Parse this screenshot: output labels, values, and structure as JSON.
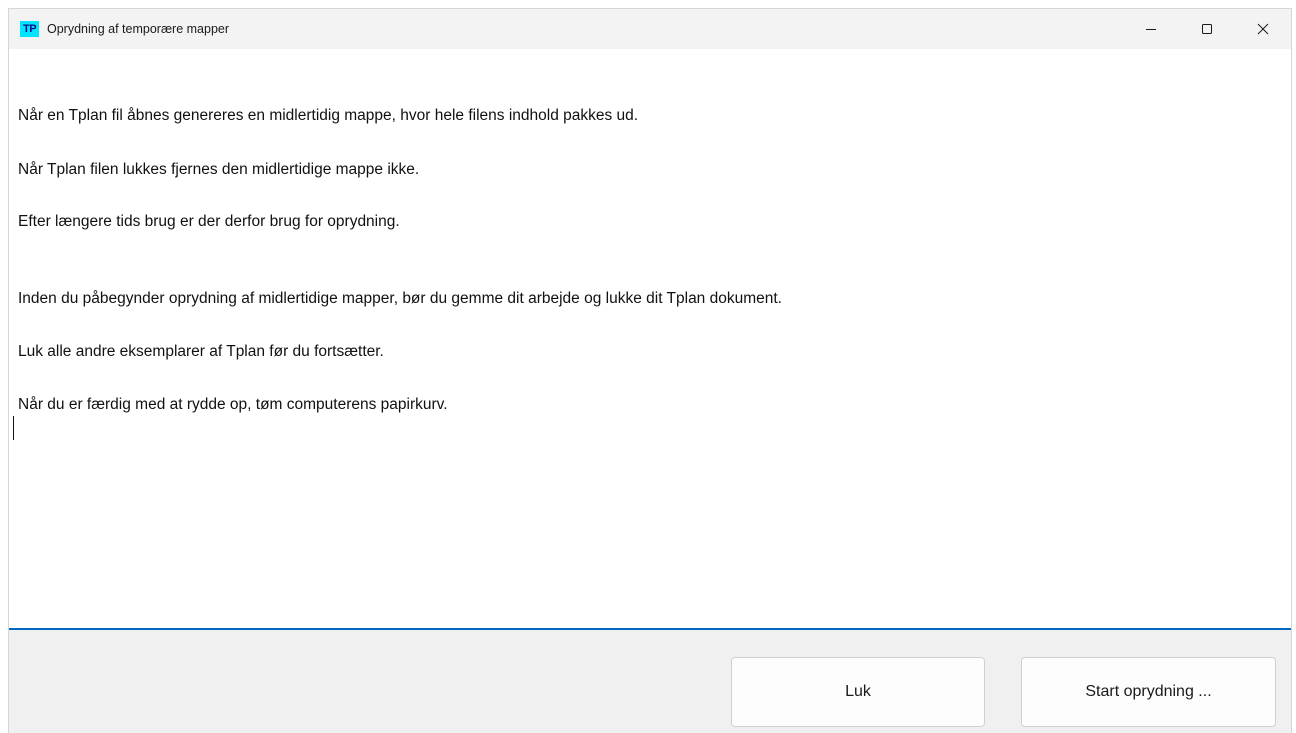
{
  "window": {
    "title": "Oprydning af temporære mapper",
    "app_icon_text": "TP"
  },
  "content": {
    "paragraphs": [
      "Når en Tplan fil åbnes genereres en midlertidig mappe, hvor hele filens indhold pakkes ud.",
      "Når Tplan filen lukkes fjernes den midlertidige mappe ikke.",
      "Efter længere tids brug er der derfor brug for oprydning.",
      "Inden du påbegynder oprydning af midlertidige mapper, bør du gemme dit arbejde og lukke dit Tplan dokument.",
      "Luk alle andre eksemplarer af Tplan før du fortsætter.",
      "Når du er færdig med at rydde op, tøm computerens papirkurv."
    ]
  },
  "footer": {
    "close_label": "Luk",
    "start_label": "Start oprydning ..."
  },
  "colors": {
    "accent": "#0067c0",
    "icon_background": "#00e5ff"
  }
}
